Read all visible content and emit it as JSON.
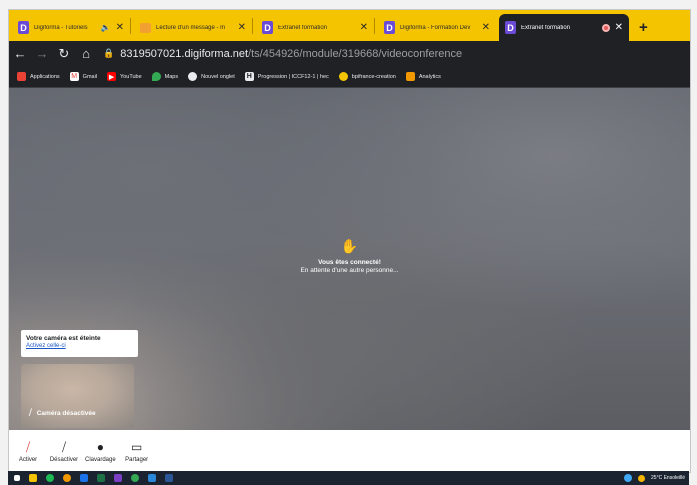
{
  "tabs": [
    {
      "label": "Digiforma - Tutoriels",
      "icon": "digiforma-icon",
      "extra": "speaker-icon"
    },
    {
      "label": "Lecture d'un message - m",
      "icon": "mail-icon"
    },
    {
      "label": "Extranet formation",
      "icon": "digiforma-icon"
    },
    {
      "label": "Digiforma - Formation Dev",
      "icon": "digiforma-icon"
    },
    {
      "label": "Extranet formation",
      "icon": "digiforma-icon",
      "active": true
    }
  ],
  "tab_letter": "D",
  "address": {
    "host": "8319507021.digiforma.net",
    "path": "/ts/454926/module/319668/videoconference"
  },
  "bookmarks": [
    {
      "label": "Applications",
      "icon": "apps-grid-icon",
      "color": "#ea4335"
    },
    {
      "label": "Gmail",
      "icon": "gmail-icon",
      "color": "#ea4335"
    },
    {
      "label": "YouTube",
      "icon": "youtube-icon",
      "color": "#ff0000"
    },
    {
      "label": "Maps",
      "icon": "maps-icon",
      "color": "#34a853"
    },
    {
      "label": "Nouvel onglet",
      "icon": "globe-icon",
      "color": "#e8eaed"
    },
    {
      "label": "Progression | ICCF12-1 | hec",
      "icon": "hec-icon",
      "color": "#e8eaed"
    },
    {
      "label": "bpifrance-creation",
      "icon": "bpi-icon",
      "color": "#f5c400"
    },
    {
      "label": "Analytics",
      "icon": "analytics-icon",
      "color": "#f29900"
    }
  ],
  "video": {
    "connected": "Vous êtes connecté!",
    "waiting": "En attente d'une autre personne..."
  },
  "camera_notice": {
    "title": "Votre caméra est éteinte",
    "link": "Activez celle-ci"
  },
  "selfview_label": "Caméra désactivée",
  "controls": [
    {
      "label": "Activer",
      "icon": "camera-off-icon"
    },
    {
      "label": "Désactiver",
      "icon": "microphone-off-icon"
    },
    {
      "label": "Clavardage",
      "icon": "chat-icon"
    },
    {
      "label": "Partager",
      "icon": "screen-share-icon"
    }
  ],
  "taskbar": {
    "weather": "25°C Ensoleillé"
  },
  "colors": {
    "tabstrip": "#f5c400",
    "digiforma": "#6b4bd6",
    "chrome_dark": "#202124",
    "controls_bg": "#ffffff",
    "taskbar": "#1b2331"
  }
}
